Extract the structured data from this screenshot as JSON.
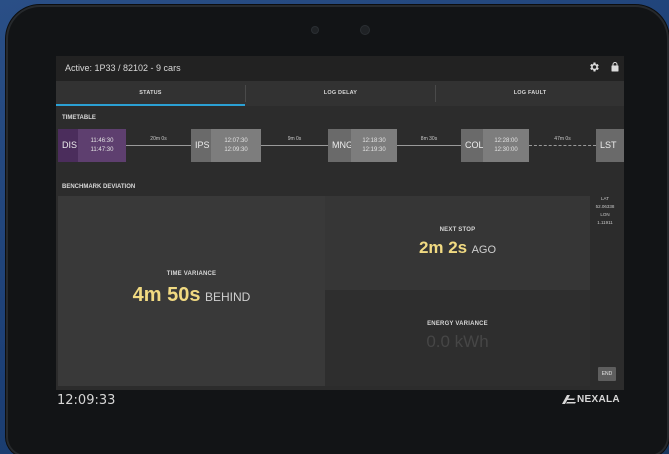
{
  "header": {
    "title": "Active: 1P33 / 82102 - 9 cars"
  },
  "icons": {
    "settings": "gear-icon",
    "lock": "lock-icon",
    "brand": "nexala-logo-icon"
  },
  "tabs": [
    {
      "label": "STATUS",
      "active": true
    },
    {
      "label": "LOG DELAY",
      "active": false
    },
    {
      "label": "LOG FAULT",
      "active": false
    }
  ],
  "timetable": {
    "label": "TIMETABLE",
    "stops": [
      {
        "code": "DIS",
        "arrive": "11:46:30",
        "depart": "11:47:30",
        "state": "current"
      },
      {
        "code": "IPS",
        "arrive": "12:07:30",
        "depart": "12:09:30",
        "state": "upcoming"
      },
      {
        "code": "MNG",
        "arrive": "12:18:30",
        "depart": "12:19:30",
        "state": "upcoming"
      },
      {
        "code": "COL",
        "arrive": "12:28:00",
        "depart": "12:30:00",
        "state": "upcoming"
      },
      {
        "code": "LST",
        "arrive": "",
        "depart": "",
        "state": "upcoming"
      }
    ],
    "segments": [
      "20m 0s",
      "9m 0s",
      "8m 30s",
      "47m 0s"
    ]
  },
  "benchmark": {
    "label": "BENCHMARK DEVIATION"
  },
  "time_variance": {
    "title": "TIME VARIANCE",
    "value": "4m 50s",
    "unit": "BEHIND"
  },
  "next_stop": {
    "title": "NEXT STOP",
    "value": "2m 2s",
    "unit": "AGO"
  },
  "energy_variance": {
    "title": "ENERGY VARIANCE",
    "value": "0.0 kWh"
  },
  "location": {
    "lat_label": "LAT",
    "lat": "52.06338",
    "lon_label": "LON",
    "lon": "1.11911"
  },
  "end_button": "END",
  "clock": "12:09:33",
  "brand": "NEXALA",
  "colors": {
    "accent": "#2ba0d4",
    "highlight": "#f1da82",
    "current_stop": "#5c3d6e"
  }
}
